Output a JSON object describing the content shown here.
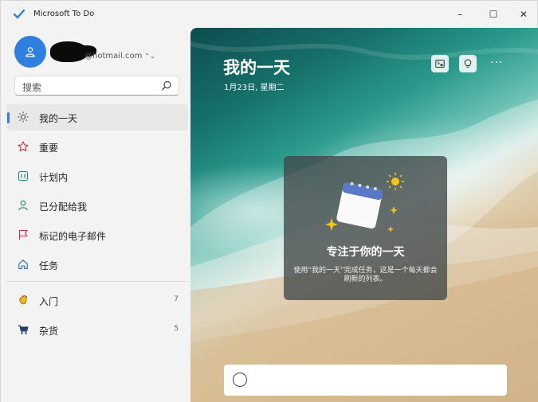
{
  "window": {
    "title": "Microsoft To Do",
    "minimize": "–",
    "maximize": "☐",
    "close": "✕"
  },
  "account": {
    "email": "@hotmail.com",
    "chevron": "⌃⌄"
  },
  "search": {
    "placeholder": "搜索"
  },
  "nav": [
    {
      "label": "我的一天",
      "icon": "sun-icon",
      "active": true
    },
    {
      "label": "重要",
      "icon": "star-icon"
    },
    {
      "label": "计划内",
      "icon": "calendar-icon"
    },
    {
      "label": "已分配给我",
      "icon": "person-icon"
    },
    {
      "label": "标记的电子邮件",
      "icon": "flag-icon"
    },
    {
      "label": "任务",
      "icon": "home-icon"
    }
  ],
  "lists": [
    {
      "label": "入门",
      "icon": "wave-hand-icon",
      "count": "7"
    },
    {
      "label": "杂货",
      "icon": "cart-icon",
      "count": "5"
    }
  ],
  "main": {
    "title": "我的一天",
    "date": "1月23日, 星期二",
    "more": "···"
  },
  "card": {
    "title": "专注于你的一天",
    "text": "使用“我的一天”完成任务，这是一个每天都会刷新的列表。"
  },
  "colors": {
    "accent": "#2f7fe0"
  }
}
